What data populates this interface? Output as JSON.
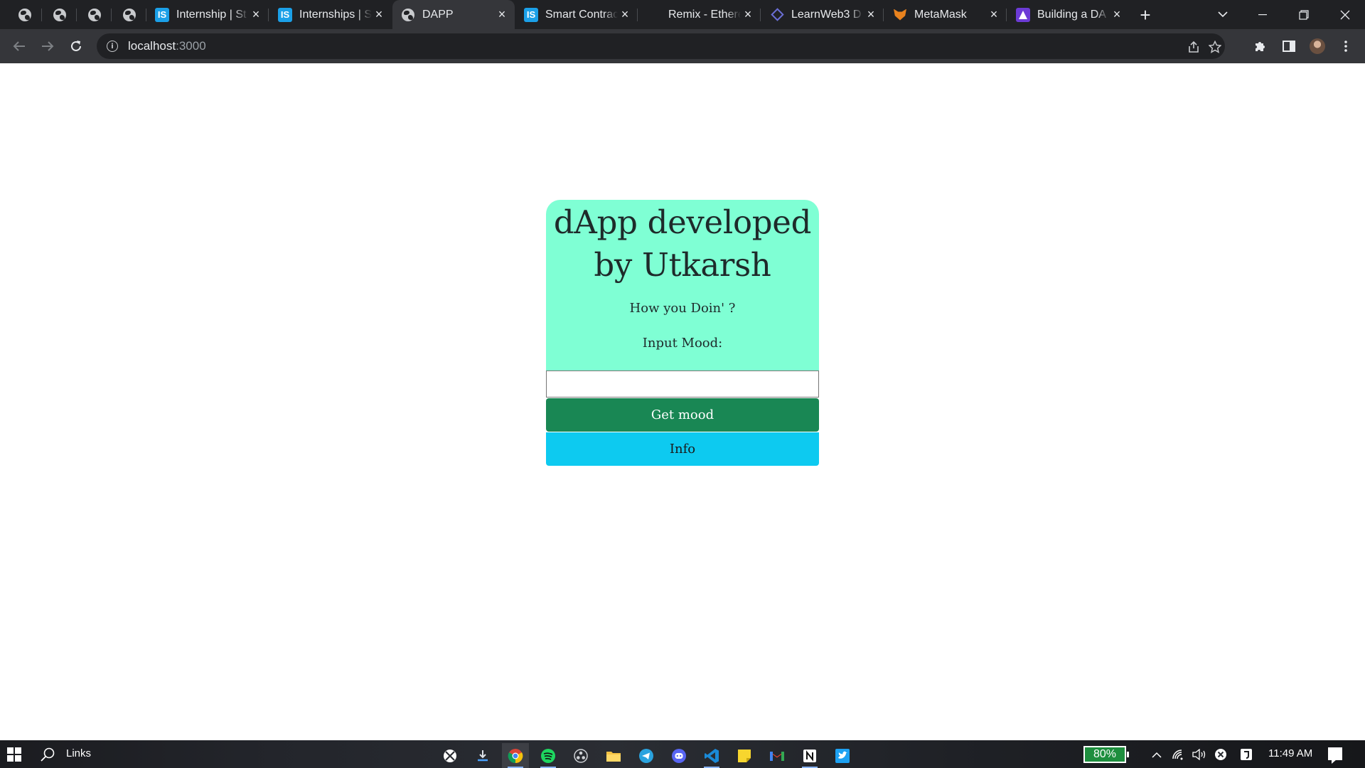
{
  "browser": {
    "tabs": [
      {
        "title": "Internship | St",
        "icon": "is-icon"
      },
      {
        "title": "Internships | S",
        "icon": "is-icon"
      },
      {
        "title": "DAPP",
        "icon": "globe-icon",
        "active": true
      },
      {
        "title": "Smart Contrac",
        "icon": "is-icon"
      },
      {
        "title": "Remix - Ethere",
        "icon": "remix-icon"
      },
      {
        "title": "LearnWeb3 D",
        "icon": "learnweb3-icon"
      },
      {
        "title": "MetaMask",
        "icon": "metamask-icon"
      },
      {
        "title": "Building a DA",
        "icon": "buildspace-icon"
      }
    ],
    "address": {
      "host": "localhost",
      "port": ":3000"
    }
  },
  "dapp": {
    "title": "dApp developed by Utkarsh",
    "greeting": "How you Doin' ?",
    "input_label": "Input Mood:",
    "input_value": "",
    "get_mood_label": "Get mood",
    "info_label": "Info",
    "colors": {
      "card": "#7fffd4",
      "get_mood": "#198754",
      "info": "#0dcaf0"
    }
  },
  "taskbar": {
    "search_label": "Links",
    "battery": "80%",
    "time": "11:49 AM"
  }
}
